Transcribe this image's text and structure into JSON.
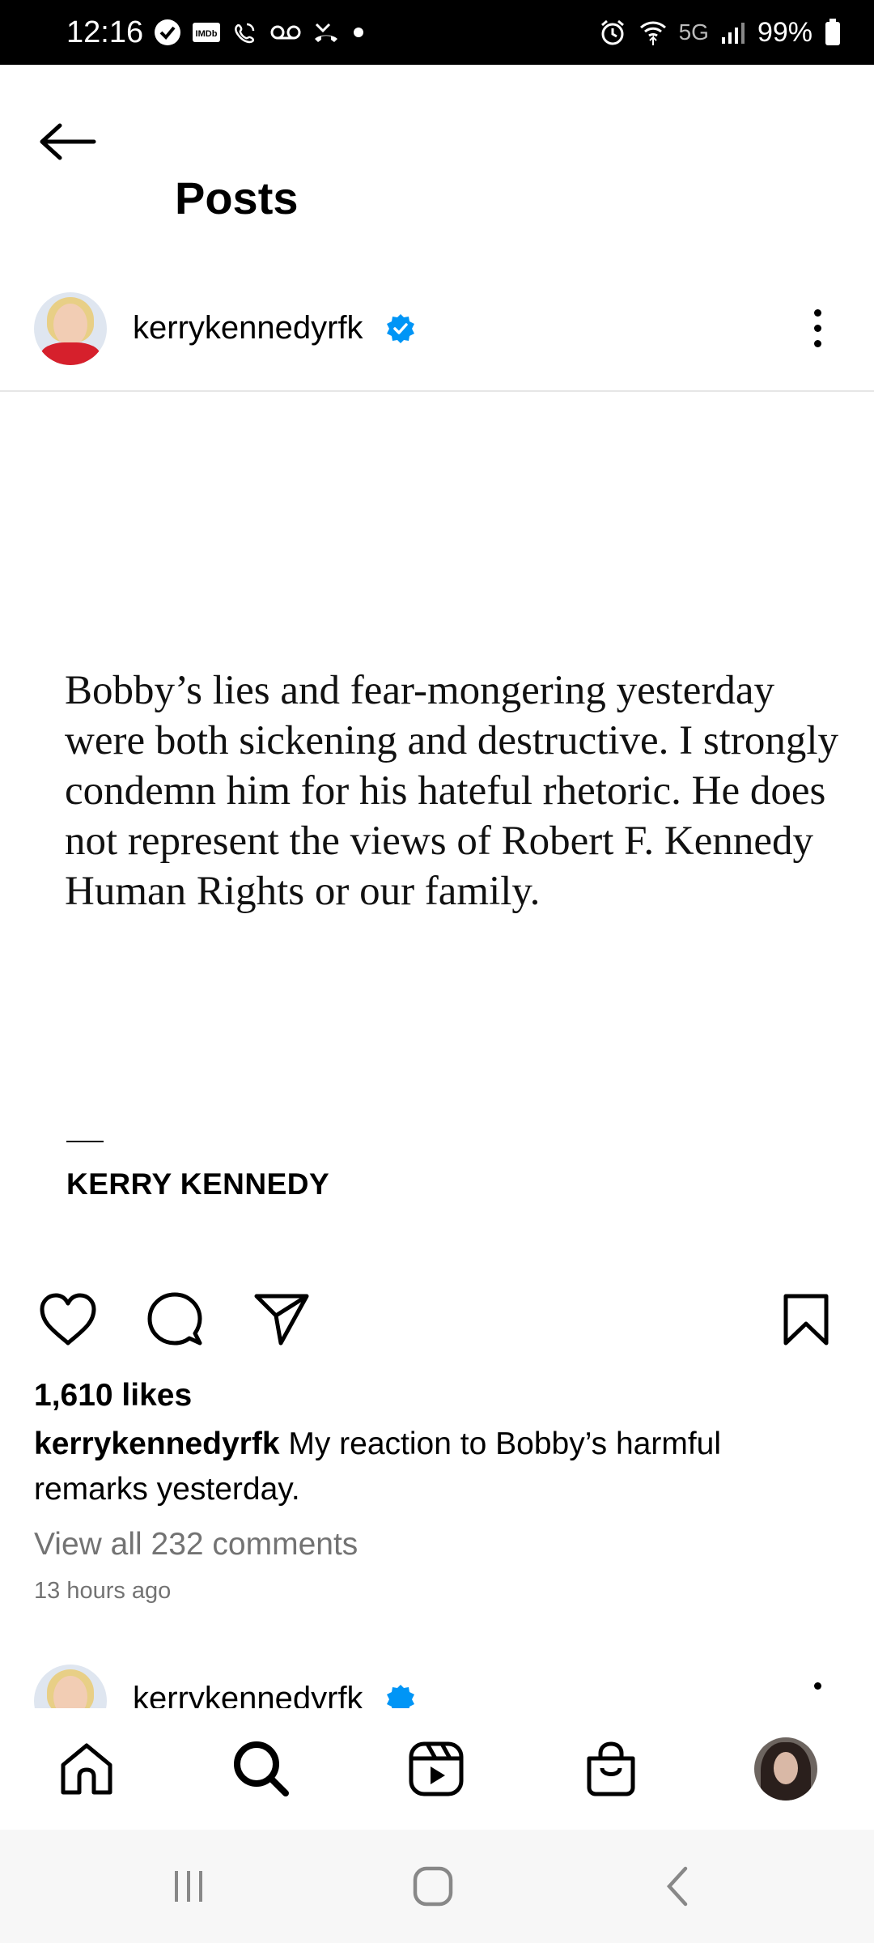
{
  "status_bar": {
    "time": "12:16",
    "network": "5G",
    "battery": "99%",
    "icons_left": [
      "check-circle-icon",
      "imdb-icon",
      "wifi-call-icon",
      "voicemail-icon",
      "missed-call-icon",
      "dot-icon"
    ],
    "icons_right": [
      "alarm-icon",
      "wifi-icon",
      "signal-icon",
      "battery-icon"
    ],
    "imdb_label": "IMDb"
  },
  "header": {
    "title": "Posts"
  },
  "post": {
    "username": "kerrykennedyrfk",
    "verified": true,
    "image": {
      "quote": "Bobby’s lies and fear-mongering yesterday were both sickening and destructive. I strongly condemn him for his hateful rhetoric. He does not represent the views of Robert F. Kennedy Human Rights or our family.",
      "attribution": "KERRY KENNEDY"
    },
    "likes": "1,610 likes",
    "caption_user": "kerrykennedyrfk",
    "caption_text": " My reaction to Bobby’s harmful remarks yesterday.",
    "view_comments": "View all 232 comments",
    "time_ago": "13 hours ago"
  },
  "next_post": {
    "username": "kerrykennedyrfk"
  },
  "colors": {
    "verified_blue": "#0095f6",
    "secondary_text": "#737373"
  }
}
